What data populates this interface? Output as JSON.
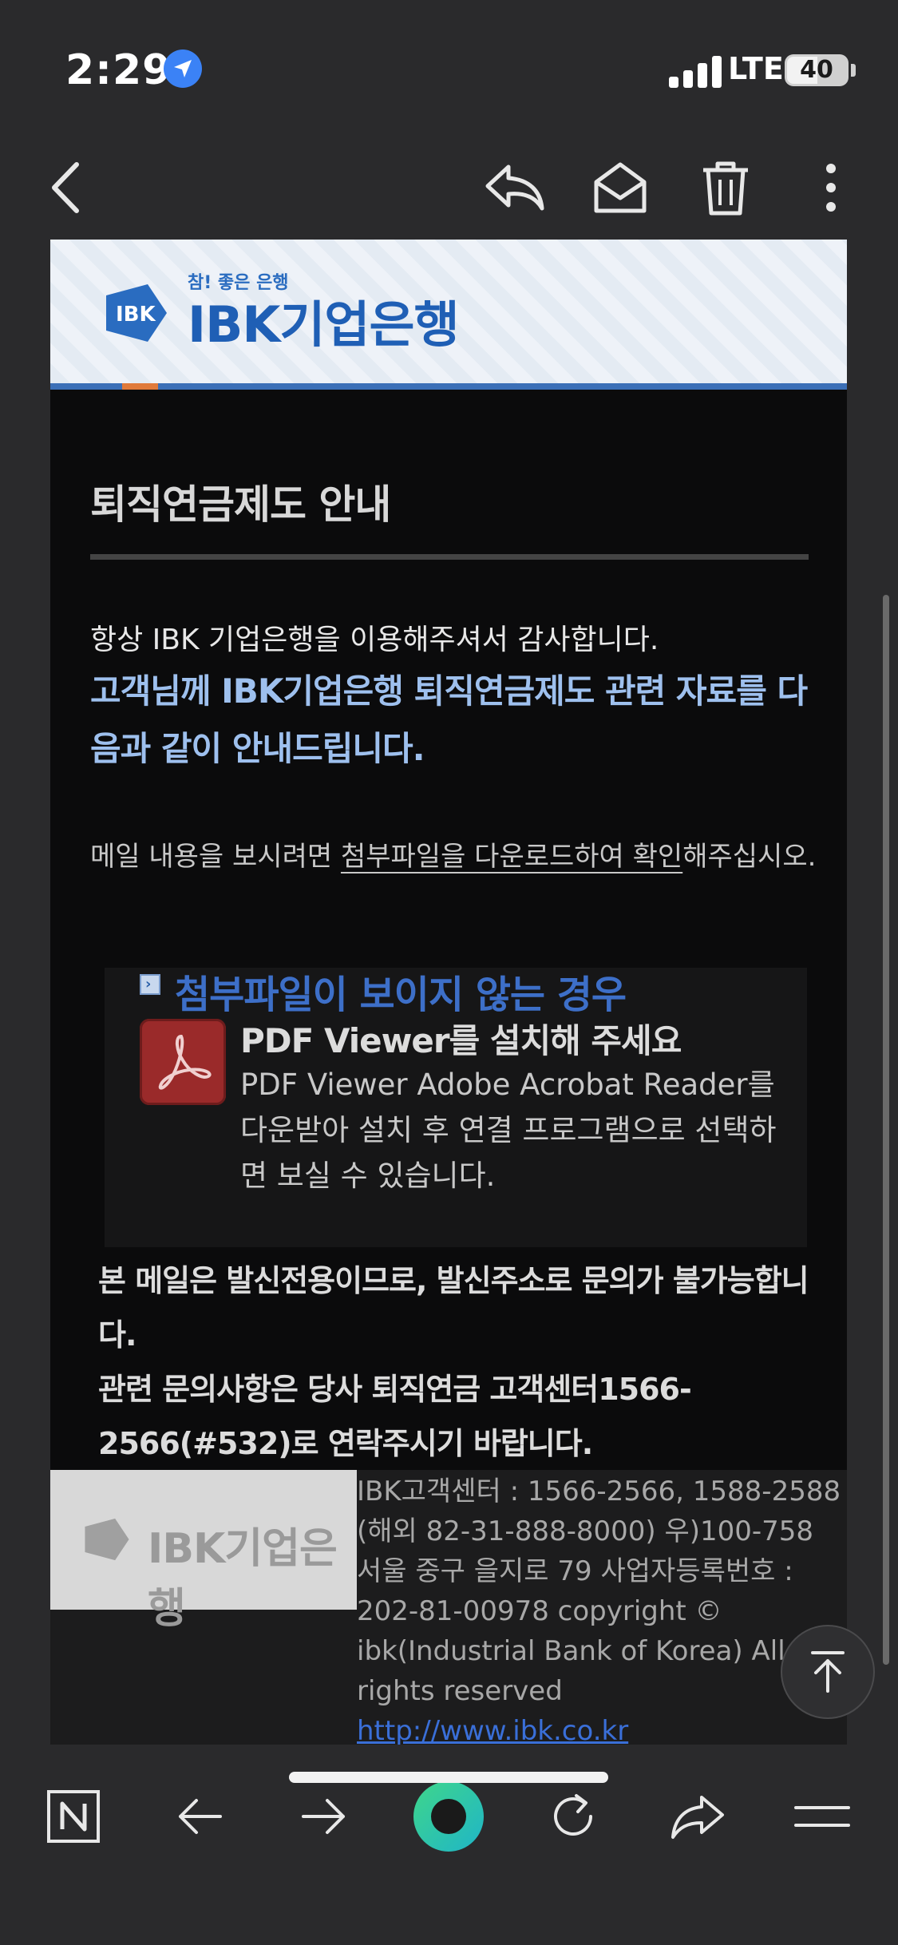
{
  "status": {
    "time": "2:29",
    "network": "LTE",
    "battery": "40",
    "icons": [
      "location-arrow-icon",
      "signal-bars-icon",
      "battery-icon"
    ]
  },
  "toolbar": {
    "icons": [
      "back-chevron-icon",
      "reply-icon",
      "mark-unread-envelope-icon",
      "trash-icon",
      "more-vertical-icon"
    ]
  },
  "email": {
    "banner": {
      "slogan": "참! 좋은 은행",
      "bank_name": "IBK기업은행",
      "logo_mark": "IBK"
    },
    "title": "퇴직연금제도 안내",
    "greeting": "항상 IBK 기업은행을 이용해주셔서 감사합니다.",
    "highlight": "고객님께 IBK기업은행 퇴직연금제도 관련 자료를 다음과 같이 안내드립니다.",
    "instruction": {
      "before": "메일 내용을 보시려면 ",
      "underlined": "첨부파일을 다운로드하여 확인",
      "after": "해주십시오."
    },
    "attachment_box": {
      "heading": "첨부파일이 보이지 않는 경우",
      "subheading": "PDF Viewer를 설치해 주세요",
      "description": "PDF Viewer Adobe Acrobat Reader를 다운받아 설치 후 연결 프로그램으로 선택하면 보실 수 있습니다."
    },
    "notice": {
      "line1": "본 메일은 발신전용이므로, 발신주소로 문의가 불가능합니다.",
      "line2": "관련 문의사항은 당사 퇴직연금 고객센터1566-2566(#532)로 연락주시기 바랍니다."
    },
    "footer": {
      "logo_text": "IBK기업은행",
      "info": "IBK고객센터 : 1566-2566, 1588-2588 (해외 82-31-888-8000) 우)100-758 서울 중구 을지로 79 사업자등록번호 : 202-81-00978 copyright © ibk(Industrial Bank of Korea) All rights reserved",
      "link": "http://www.ibk.co.kr"
    }
  },
  "bottom_nav": {
    "icons": [
      "naver-n-icon",
      "back-arrow-icon",
      "forward-arrow-icon",
      "green-dot-icon",
      "refresh-icon",
      "share-icon",
      "menu-icon"
    ]
  },
  "colors": {
    "background": "#2a2a2c",
    "email_bg": "#0b0b0c",
    "accent_blue": "#9ec0ee",
    "brand_blue": "#1f5fb5",
    "green": "#3fd68a"
  }
}
